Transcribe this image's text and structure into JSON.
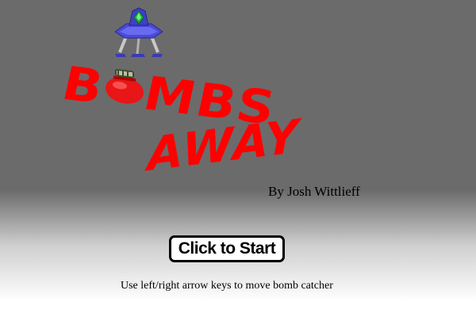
{
  "title": {
    "line1": "BOMBS",
    "line2": "AWAY",
    "color": "#ff0000"
  },
  "author": "By Josh Wittlieff",
  "start_button": {
    "label": "Click to Start"
  },
  "instructions": "Use left/right arrow keys to move bomb catcher",
  "icons": {
    "ship": "alien-ship-icon",
    "bomb": "bomb-icon"
  },
  "colors": {
    "background_top": "#6b6b6b",
    "background_bottom": "#ffffff",
    "ship_body": "#4a4ad8",
    "ship_gem": "#1fae3a",
    "bomb_body": "#e81616"
  }
}
